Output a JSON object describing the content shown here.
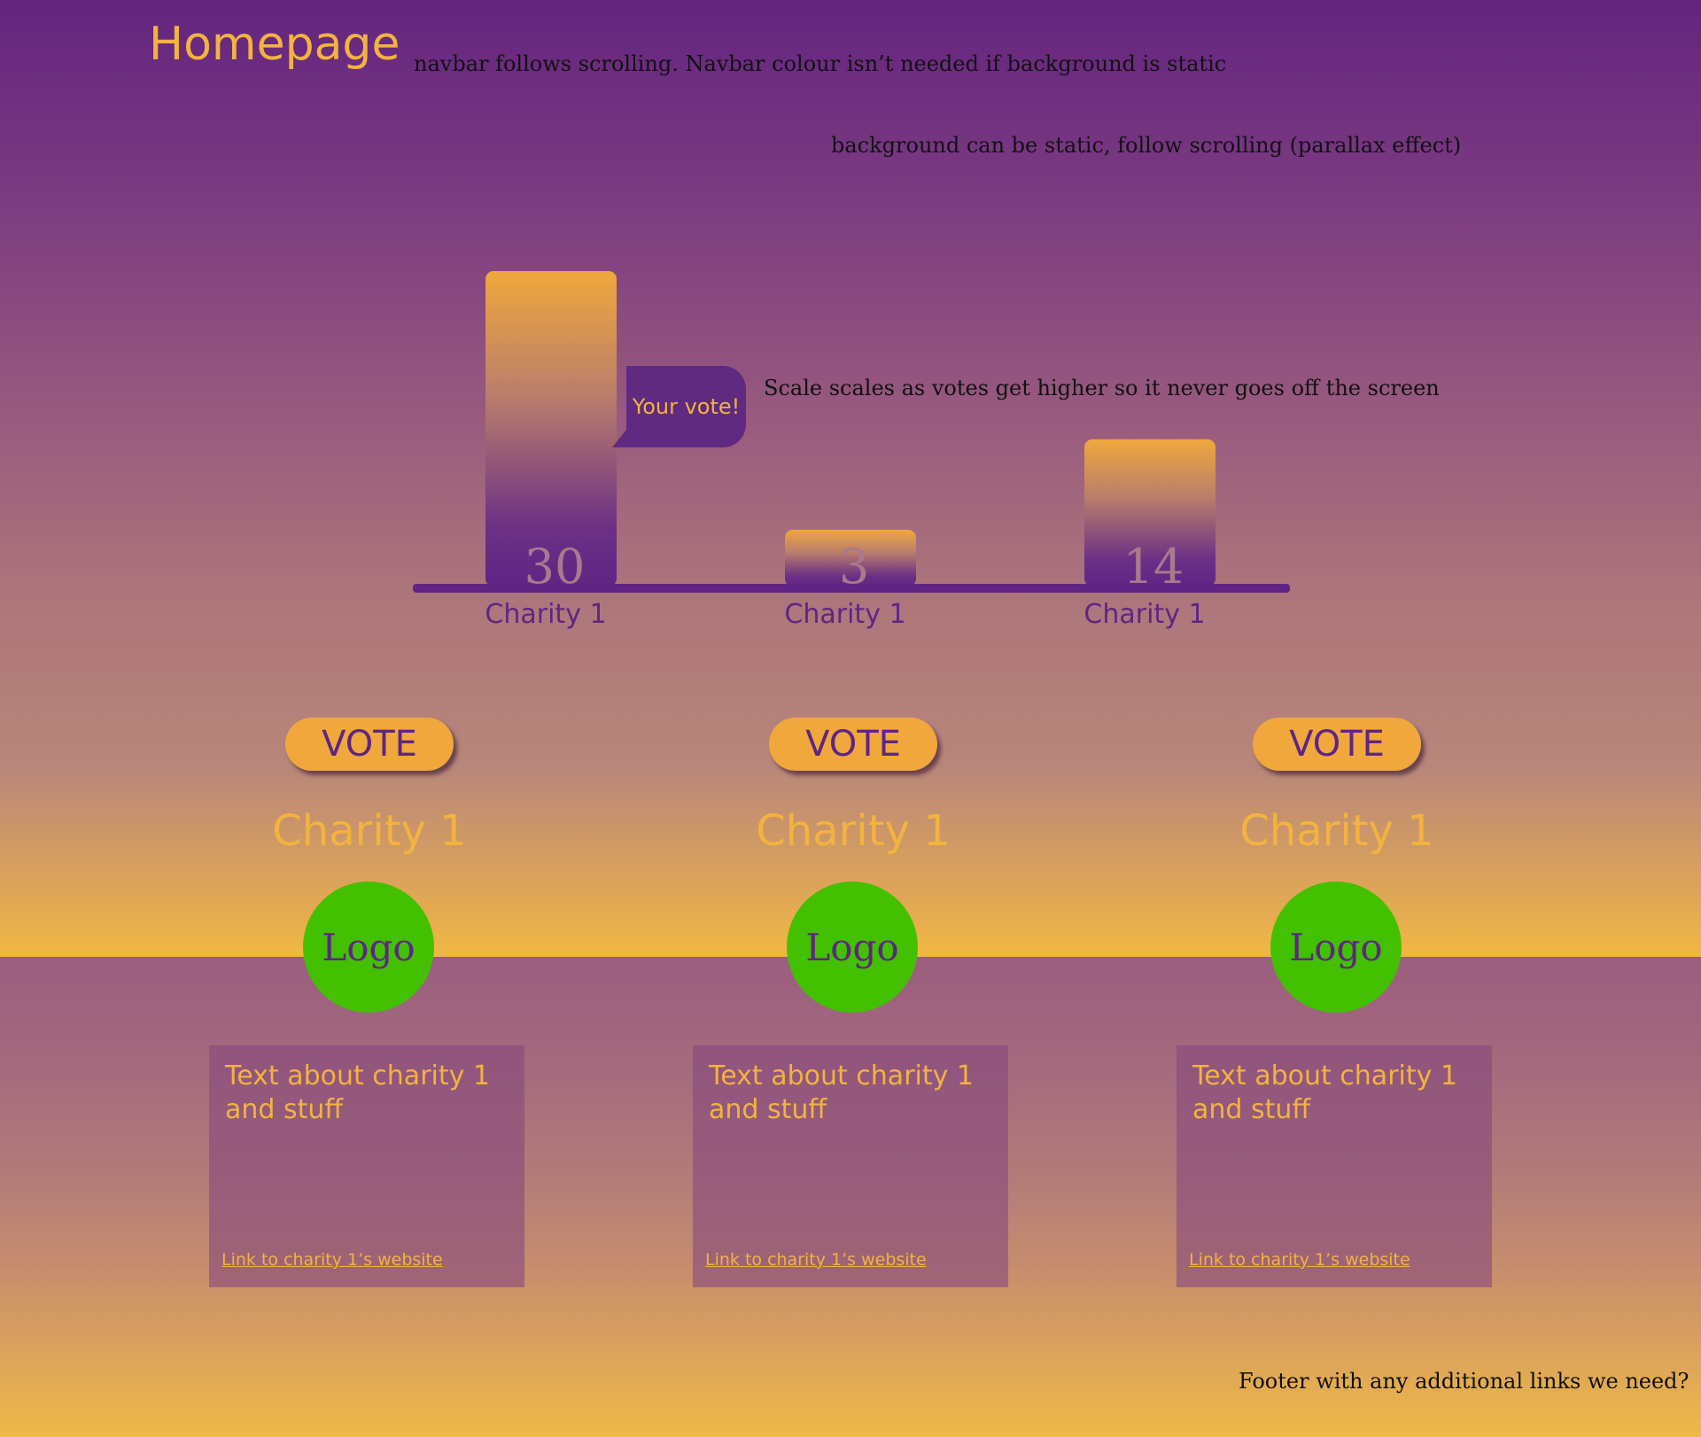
{
  "page": {
    "title": "Homepage",
    "colors": {
      "purple": "#5f2585",
      "orange": "#f0a83c",
      "yellow": "#f2b33f",
      "logo_green": "#43c100"
    }
  },
  "notes": {
    "navbar": "navbar follows scrolling. Navbar colour isn’t needed if background is static",
    "background": "background can be static, follow scrolling (parallax effect)",
    "scale": "Scale scales as votes get higher so it never goes off the screen",
    "footer": "Footer with any additional links we need?"
  },
  "chart_data": {
    "type": "bar",
    "categories": [
      "Charity 1",
      "Charity 1",
      "Charity 1"
    ],
    "values": [
      30,
      3,
      14
    ],
    "annotation": "Your vote!",
    "annotation_bar_index": 0
  },
  "charities": [
    {
      "vote_label": "VOTE",
      "name": "Charity 1",
      "logo_text": "Logo",
      "description": "Text about charity 1 and stuff",
      "link_text": "Link to charity 1’s website"
    },
    {
      "vote_label": "VOTE",
      "name": "Charity 1",
      "logo_text": "Logo",
      "description": "Text about charity 1 and stuff",
      "link_text": "Link to charity 1’s website"
    },
    {
      "vote_label": "VOTE",
      "name": "Charity 1",
      "logo_text": "Logo",
      "description": "Text about charity 1 and stuff",
      "link_text": "Link to charity 1’s website"
    }
  ]
}
